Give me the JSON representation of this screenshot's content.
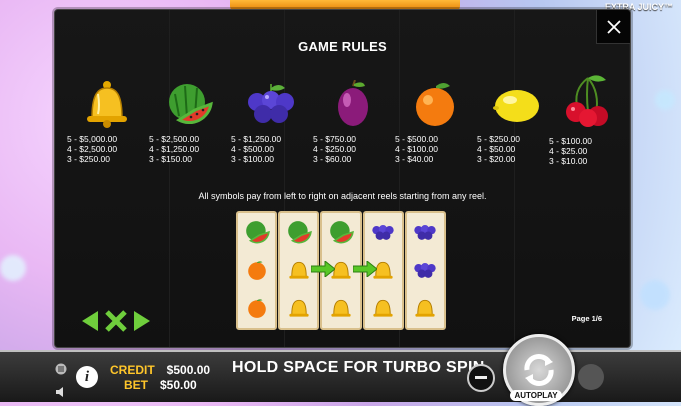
{
  "game": {
    "brand": "EXTRA JUICY™"
  },
  "rules": {
    "title": "GAME RULES",
    "description": "All symbols pay from left to right on adjacent reels starting from any reel.",
    "page": "Page 1/6"
  },
  "symbols": [
    {
      "icon": "bell-icon",
      "pays": [
        "5 - $5,000.00",
        "4 - $2,500.00",
        "3 - $250.00"
      ]
    },
    {
      "icon": "watermelon-icon",
      "pays": [
        "5 - $2,500.00",
        "4 - $1,250.00",
        "3 - $150.00"
      ]
    },
    {
      "icon": "grapes-icon",
      "pays": [
        "5 - $1,250.00",
        "4 - $500.00",
        "3 - $100.00"
      ]
    },
    {
      "icon": "plum-icon",
      "pays": [
        "5 - $750.00",
        "4 - $250.00",
        "3 - $60.00"
      ]
    },
    {
      "icon": "orange-icon",
      "pays": [
        "5 - $500.00",
        "4 - $100.00",
        "3 - $40.00"
      ]
    },
    {
      "icon": "lemon-icon",
      "pays": [
        "5 - $250.00",
        "4 - $50.00",
        "3 - $20.00"
      ]
    },
    {
      "icon": "cherry-icon",
      "pays": [
        "5 - $100.00",
        "4 - $25.00",
        "3 - $10.00"
      ]
    }
  ],
  "example_reels": [
    [
      "watermelon",
      "orange",
      "orange"
    ],
    [
      "watermelon",
      "bell",
      "bell"
    ],
    [
      "watermelon",
      "bell",
      "bell"
    ],
    [
      "grapes",
      "bell",
      "bell"
    ],
    [
      "grapes",
      "grapes",
      "bell"
    ]
  ],
  "bar": {
    "credit_label": "CREDIT",
    "credit_value": "$500.00",
    "bet_label": "BET",
    "bet_value": "$50.00",
    "message": "HOLD SPACE FOR TURBO SPIN",
    "autoplay_label": "AUTOPLAY"
  },
  "colors": {
    "accent_yellow": "#ffc62a",
    "nav_green": "#6fce3c"
  }
}
